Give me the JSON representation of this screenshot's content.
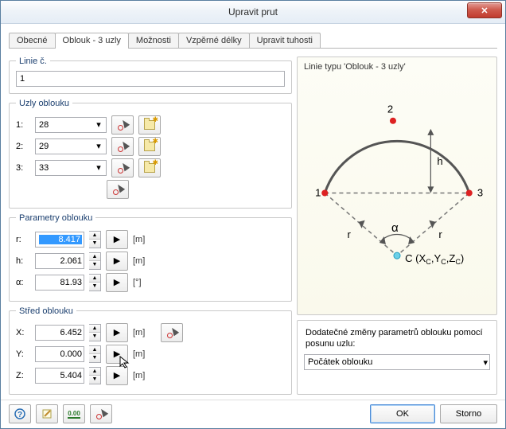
{
  "window": {
    "title": "Upravit prut"
  },
  "tabs": [
    "Obecné",
    "Oblouk - 3 uzly",
    "Možnosti",
    "Vzpěrné délky",
    "Upravit tuhosti"
  ],
  "active_tab": 1,
  "line_no": {
    "legend": "Linie č.",
    "value": "1"
  },
  "nodes": {
    "legend": "Uzly oblouku",
    "rows": [
      {
        "label": "1:",
        "value": "28"
      },
      {
        "label": "2:",
        "value": "29"
      },
      {
        "label": "3:",
        "value": "33"
      }
    ]
  },
  "params": {
    "legend": "Parametry oblouku",
    "r": {
      "label": "r:",
      "value": "8.417",
      "unit": "[m]",
      "selected": true
    },
    "h": {
      "label": "h:",
      "value": "2.061",
      "unit": "[m]"
    },
    "a": {
      "label": "α:",
      "value": "81.93",
      "unit": "[°]"
    }
  },
  "center": {
    "legend": "Střed oblouku",
    "x": {
      "label": "X:",
      "value": "6.452",
      "unit": "[m]"
    },
    "y": {
      "label": "Y:",
      "value": "0.000",
      "unit": "[m]"
    },
    "z": {
      "label": "Z:",
      "value": "5.404",
      "unit": "[m]"
    }
  },
  "diagram": {
    "legend": "Linie typu 'Oblouk - 3 uzly'",
    "labels": {
      "p1": "1",
      "p2": "2",
      "p3": "3",
      "h": "h",
      "r": "r",
      "alpha": "α",
      "c": "C (X",
      "csub1": "C",
      "cmid": ",Y",
      "csub2": "C",
      "cmid2": ",Z",
      "csub3": "C",
      "cend": ")"
    }
  },
  "additional": {
    "legend": "Dodatečné změny parametrů oblouku pomocí posunu uzlu:",
    "selected": "Počátek oblouku"
  },
  "buttons": {
    "ok": "OK",
    "cancel": "Storno"
  }
}
